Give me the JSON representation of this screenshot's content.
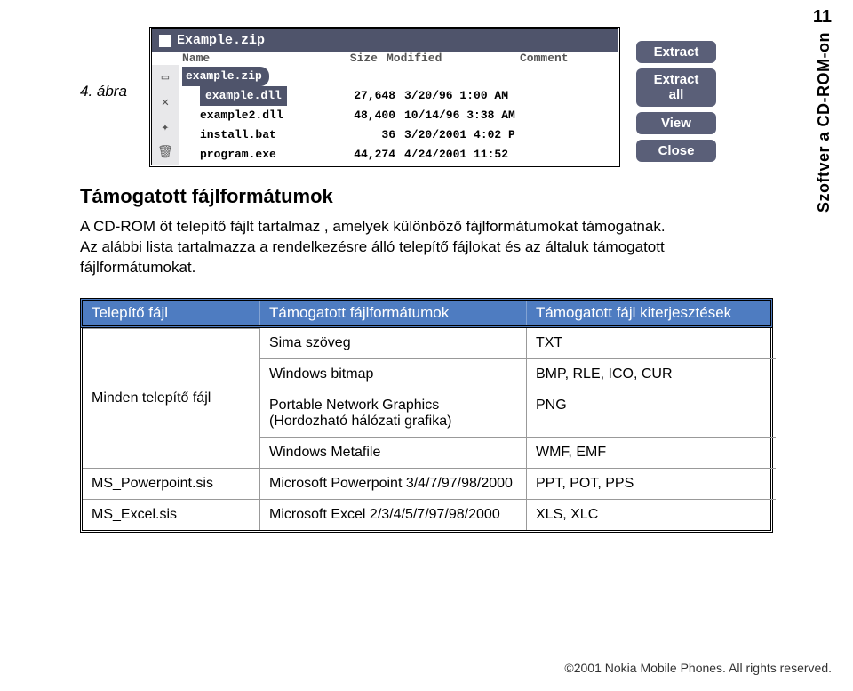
{
  "page_number": "11",
  "side_label": "Szoftver a CD-ROM-on",
  "figure_label": "4. ábra",
  "archive": {
    "title": "Example.zip",
    "columns": {
      "name": "Name",
      "size": "Size",
      "modified": "Modified",
      "comment": "Comment"
    },
    "rows": [
      {
        "name": "example.zip",
        "size": "",
        "modified": "",
        "kind": "zip"
      },
      {
        "name": "example.dll",
        "size": "27,648",
        "modified": "3/20/96 1:00 AM",
        "kind": "sel"
      },
      {
        "name": "example2.dll",
        "size": "48,400",
        "modified": "10/14/96 3:38 AM",
        "kind": ""
      },
      {
        "name": "install.bat",
        "size": "36",
        "modified": "3/20/2001 4:02 P",
        "kind": ""
      },
      {
        "name": "program.exe",
        "size": "44,274",
        "modified": "4/24/2001 11:52",
        "kind": ""
      }
    ]
  },
  "buttons": {
    "extract": "Extract",
    "extract_all_l1": "Extract",
    "extract_all_l2": "all",
    "view": "View",
    "close": "Close"
  },
  "section": {
    "title": "Támogatott fájlformátumok",
    "p1": "A CD-ROM öt telepítő fájlt tartalmaz , amelyek különböző fájlformátumokat támogatnak. Az alábbi lista tartalmazza a rendelkezésre álló telepítő fájlokat és az általuk támogatott fájlformátumokat."
  },
  "table": {
    "headers": {
      "c1": "Telepítő fájl",
      "c2": "Támogatott fájlformátumok",
      "c3": "Támogatott fájl kiterjesztések"
    },
    "group1_label": "Minden telepítő fájl",
    "group1": [
      {
        "fmt": "Sima szöveg",
        "ext": "TXT"
      },
      {
        "fmt": "Windows bitmap",
        "ext": "BMP, RLE, ICO, CUR"
      },
      {
        "fmt": "Portable Network Graphics (Hordozható hálózati grafika)",
        "ext": "PNG"
      },
      {
        "fmt": "Windows Metafile",
        "ext": "WMF, EMF"
      }
    ],
    "group2_label": "MS_Powerpoint.sis",
    "group2": [
      {
        "fmt": "Microsoft Powerpoint 3/4/7/97/98/2000",
        "ext": "PPT, POT, PPS"
      }
    ],
    "group3_label": "MS_Excel.sis",
    "group3": [
      {
        "fmt": "Microsoft Excel 2/3/4/5/7/97/98/2000",
        "ext": "XLS, XLC"
      }
    ]
  },
  "footer": "©2001 Nokia Mobile Phones. All rights reserved."
}
